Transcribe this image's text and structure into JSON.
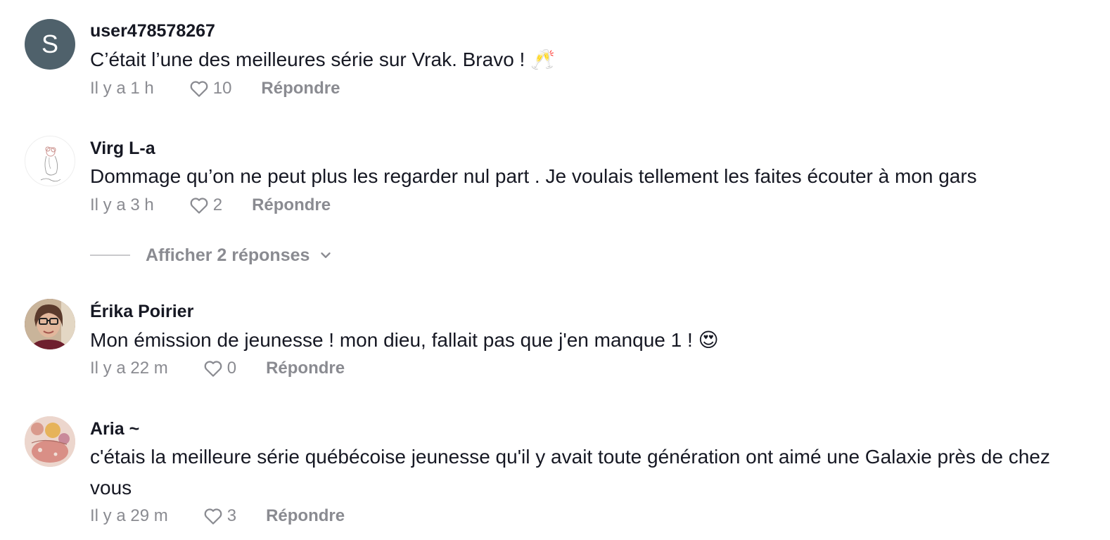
{
  "reply_label": "Répondre",
  "comments": [
    {
      "username": "user478578267",
      "avatar_initial": "S",
      "text": "C’était l’une des meilleures série sur Vrak. Bravo ! 🥂",
      "time": "Il y a 1 h",
      "likes": "10"
    },
    {
      "username": "Virg L-a",
      "text": "Dommage qu’on ne peut plus les regarder nul part . Je voulais tellement les faites écouter à mon gars",
      "time": "Il y a 3 h",
      "likes": "2",
      "view_replies": "Afficher 2 réponses"
    },
    {
      "username": "Érika Poirier",
      "text": "Mon émission de jeunesse ! mon dieu, fallait pas que j'en manque 1 ! 😍",
      "time": "Il y a 22 m",
      "likes": "0"
    },
    {
      "username": "Aria ~",
      "text": "c'étais la meilleure série québécoise jeunesse qu'il y avait toute génération ont aimé une Galaxie près de chez vous",
      "time": "Il y a 29 m",
      "likes": "3"
    }
  ],
  "colors": {
    "text": "#161823",
    "muted": "#8a8b91",
    "avatar_bg": "#4f616b"
  }
}
